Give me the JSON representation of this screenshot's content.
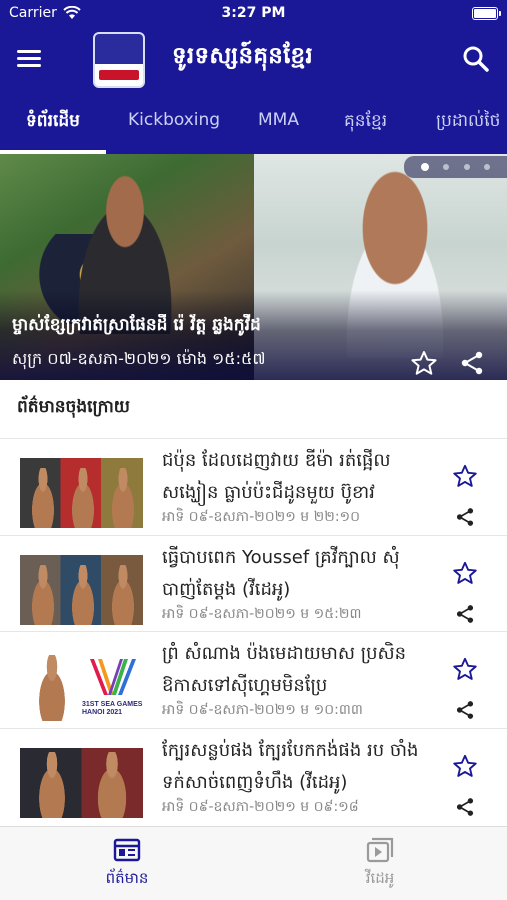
{
  "status_bar": {
    "carrier": "Carrier",
    "time": "3:27 PM"
  },
  "app_bar": {
    "title": "ទូរទស្សន៍គុនខ្មែរ",
    "menu_icon": "hamburger-menu-icon",
    "search_icon": "search-icon"
  },
  "tabs": [
    {
      "label": "ទំព័រដើម",
      "active": true
    },
    {
      "label": "Kickboxing",
      "active": false
    },
    {
      "label": "MMA",
      "active": false
    },
    {
      "label": "គុនខ្មែរ",
      "active": false
    },
    {
      "label": "ប្រដាល់ថៃ",
      "active": false
    }
  ],
  "hero": {
    "title": "ម្ចាស់ខ្សែក្រវាត់ស្រាផែនដី រ៉េ វ័ត្ត ឆ្លងកូវីដ",
    "date": "សុក្រ ០៧-ឧសភា-២០២១ ម៉ោង ១៥:៥៧",
    "slide_count": 4,
    "active_slide": 1
  },
  "latest_section": {
    "title": "ព័ត៌មានចុងក្រោយ"
  },
  "articles": [
    {
      "headline": "ជប៉ុន ដែលដេញវាយ ឌីម៉ា រត់ផ្អើល សង្ឃៀន ធ្លាប់ប៉ះជីដូនមួយ ប៊ូខាវ",
      "date": "អាទិ ០៩-ឧសភា-២០២១ ម ២២:១០"
    },
    {
      "headline": "ធ្វើបាបពេក Youssef គ្រវីក្បាល សុំបាញ់តែម្តង (វីដេអូ)",
      "date": "អាទិ ០៩-ឧសភា-២០២១ ម ១៥:២៣"
    },
    {
      "headline": "ព្រំ សំណាង ប៉ងមេដាយមាស ប្រសិនឱកាសទៅស៊ីហ្គេមមិនប្រែ",
      "date": "អាទិ ០៩-ឧសភា-២០២១ ម ១០:៣៣"
    },
    {
      "headline": "ក្បែរសន្លប់ផង ក្បែរបែកកង់ផង រប ចាំង ទក់សាច់ពេញទំហឹង (វីដេអូ)",
      "date": "អាទិ ០៩-ឧសភា-២០២១ ម ០៩:១៨"
    }
  ],
  "thumb_texts": {
    "sea_games_line1": "31ST SEA GAMES",
    "sea_games_line2": "HANOI 2021"
  },
  "bottom_nav": [
    {
      "label": "ព័ត៌មាន",
      "icon": "newspaper-icon",
      "active": true
    },
    {
      "label": "វីដេអូ",
      "icon": "video-play-icon",
      "active": false
    }
  ],
  "colors": {
    "primary": "#1a1896",
    "inactive": "#9a9a9a",
    "background": "#ffffff"
  }
}
